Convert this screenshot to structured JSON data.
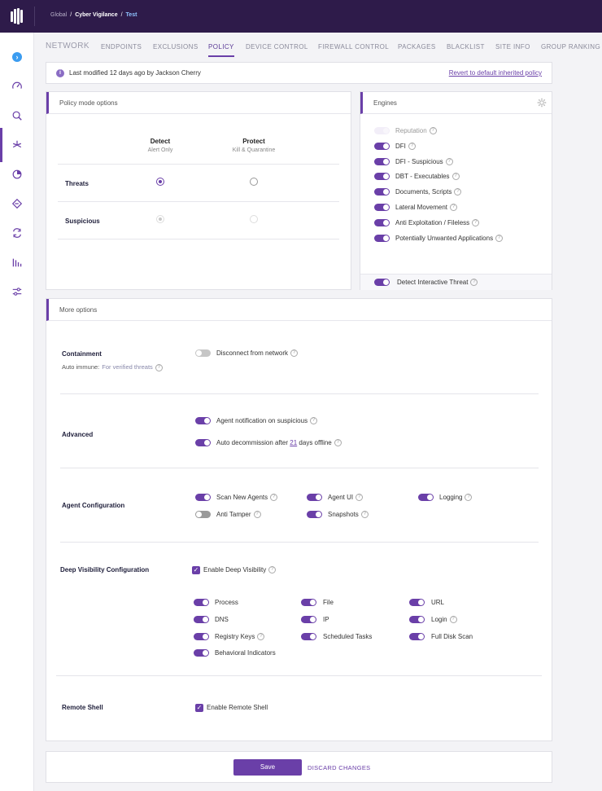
{
  "breadcrumb": {
    "items": [
      "Global",
      "Cyber Vigilance",
      "Test"
    ]
  },
  "tabs": [
    "NETWORK",
    "ENDPOINTS",
    "EXCLUSIONS",
    "POLICY",
    "DEVICE CONTROL",
    "FIREWALL CONTROL",
    "PACKAGES",
    "BLACKLIST",
    "SITE INFO",
    "GROUP RANKING"
  ],
  "active_tab": "POLICY",
  "modified": {
    "text": "Last modified 12 days ago by Jackson Cherry",
    "revert_label": "Revert to default inherited policy"
  },
  "policy_mode": {
    "title": "Policy mode options",
    "columns": [
      {
        "title": "Detect",
        "subtitle": "Alert Only"
      },
      {
        "title": "Protect",
        "subtitle": "Kill & Quarantine"
      }
    ],
    "rows": [
      {
        "label": "Threats",
        "selected": "Detect",
        "enabled": true
      },
      {
        "label": "Suspicious",
        "selected": "Detect",
        "enabled": false
      }
    ]
  },
  "engines": {
    "title": "Engines",
    "items": [
      {
        "label": "Reputation",
        "on": false,
        "disabled": true
      },
      {
        "label": "DFI",
        "on": true
      },
      {
        "label": "DFI - Suspicious",
        "on": true
      },
      {
        "label": "DBT - Executables",
        "on": true
      },
      {
        "label": "Documents, Scripts",
        "on": true
      },
      {
        "label": "Lateral Movement",
        "on": true
      },
      {
        "label": "Anti Exploitation / Fileless",
        "on": true
      },
      {
        "label": "Potentially Unwanted Applications",
        "on": true
      }
    ],
    "footer_label": "Detect Interactive Threat",
    "footer_on": true
  },
  "more_options": {
    "title": "More options",
    "containment": {
      "label": "Containment",
      "auto_immune_label": "Auto immune:",
      "auto_immune_value": "For verified threats",
      "disconnect_label": "Disconnect from network",
      "disconnect_on": false
    },
    "advanced": {
      "label": "Advanced",
      "notification_label": "Agent notification on suspicious",
      "decommission_prefix": "Auto decommission after",
      "decommission_days": "21",
      "decommission_suffix": "days offline"
    },
    "agent_config": {
      "label": "Agent Configuration",
      "items": [
        {
          "label": "Scan New Agents",
          "on": true
        },
        {
          "label": "Agent UI",
          "on": true
        },
        {
          "label": "Logging",
          "on": true
        },
        {
          "label": "Anti Tamper",
          "on": false
        },
        {
          "label": "Snapshots",
          "on": true
        }
      ]
    },
    "deep_visibility": {
      "label": "Deep Visibility Configuration",
      "enable_label": "Enable Deep Visibility",
      "items": [
        "Process",
        "File",
        "URL",
        "DNS",
        "IP",
        "Login",
        "Registry Keys",
        "Scheduled Tasks",
        "Full Disk Scan",
        "Behavioral Indicators"
      ]
    },
    "remote_shell": {
      "label": "Remote Shell",
      "enable_label": "Enable Remote Shell"
    }
  },
  "actions": {
    "save_label": "Save",
    "discard_label": "DISCARD CHANGES"
  },
  "colors": {
    "accent": "#6a3fa8",
    "topbar": "#2e1b4a"
  }
}
